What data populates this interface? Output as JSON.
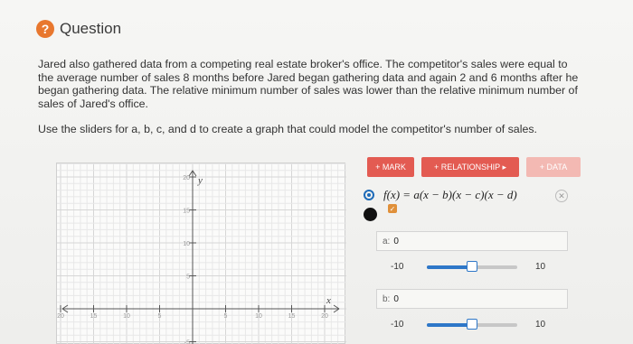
{
  "header": {
    "icon": "question-icon",
    "title": "Question"
  },
  "paragraph1": "Jared also gathered data from a competing real estate broker's office. The competitor's sales were equal to the average number of sales 8 months before Jared began gathering data and again 2 and 6 months after he began gathering data. The relative minimum number of sales was lower than the relative minimum number of sales of Jared's office.",
  "paragraph2": "Use the sliders for a, b, c, and d to create a graph that could model the competitor's number of sales.",
  "graph": {
    "x_ticks": [
      "20",
      "15",
      "10",
      "5",
      "5",
      "10",
      "15",
      "20"
    ],
    "x_tick_values": [
      -20,
      -15,
      -10,
      -5,
      5,
      10,
      15,
      20
    ],
    "y_ticks": [
      "20",
      "15",
      "10",
      "5",
      "-5"
    ],
    "y_tick_values": [
      20,
      15,
      10,
      5,
      -5
    ],
    "x_axis_label": "x",
    "y_axis_label": "y"
  },
  "toolbar": {
    "mark_label": "+ MARK",
    "relationship_label": "+ RELATIONSHIP ▸",
    "data_label": "+ DATA"
  },
  "function": {
    "expression": "f(x) = a(x − b)(x − c)(x − d)",
    "check": "✓"
  },
  "var_a": {
    "label": "a:",
    "value": "0",
    "min": "-10",
    "max": "10",
    "level": 0.5
  },
  "var_b": {
    "label": "b:",
    "value": "0",
    "min": "-10",
    "max": "10",
    "level": 0.5
  },
  "colors": {
    "accent": "#e35b52",
    "slider": "#2e77c8",
    "icon": "#e8772e"
  }
}
